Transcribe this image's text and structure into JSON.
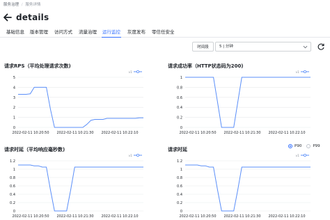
{
  "breadcrumb": {
    "root": "服务治理",
    "separator": "/",
    "current": "服务详情"
  },
  "page": {
    "title": "details"
  },
  "tabs": [
    "基础信息",
    "版本管理",
    "访问方式",
    "流量治理",
    "运行监控",
    "灰度发布",
    "零信任安全"
  ],
  "active_tab": "运行监控",
  "toolbar": {
    "time_label": "时间段",
    "time_value": "5 | 分钟"
  },
  "colors": {
    "accent": "#3370ff",
    "line": "#5b8ff9"
  },
  "charts": [
    {
      "title": "请求RPS（平均处理请求次数)",
      "legend": "v1"
    },
    {
      "title": "请求成功率（HTTP状态码为200)",
      "legend": "v1"
    },
    {
      "title": "请求时延（平均响应毫秒数)",
      "legend": "v1"
    },
    {
      "title": "请求时延",
      "legend": "v1"
    }
  ],
  "latency_percentiles": {
    "options": [
      "P90",
      "P99"
    ],
    "selected": "P90"
  },
  "chart_data": [
    {
      "type": "line",
      "title": "请求RPS（平均处理请求次数)",
      "ylim": [
        0,
        5
      ],
      "yticks": [
        "0",
        "1",
        "2",
        "3",
        "4",
        "5"
      ],
      "xticks": [
        "2022-02-11 10:20:50",
        "2022-02-11 10:21:30",
        "2022-02-11 10:22:10"
      ],
      "series": [
        {
          "name": "v1",
          "values": [
            3.3,
            3.3,
            3.3,
            3.35,
            4.0,
            4.0,
            4.0,
            4.0,
            1.8,
            0.0,
            0.0,
            0.0,
            0.0,
            0.0,
            0.0,
            0.0,
            0.0,
            0.3,
            0.7,
            0.8,
            0.8,
            0.8,
            0.9,
            0.9,
            0.9,
            0.9,
            0.9,
            0.9,
            0.9,
            0.9,
            0.95,
            0.95
          ]
        }
      ]
    },
    {
      "type": "line",
      "title": "请求成功率（HTTP状态码为200)",
      "ylim": [
        0,
        1
      ],
      "yticks": [
        "0",
        "0.2",
        "0.4",
        "0.6",
        "0.8",
        "1"
      ],
      "xticks": [
        "2022-02-11 10:20:50",
        "2022-02-11 10:21:30",
        "2022-02-11 10:22:10"
      ],
      "series": [
        {
          "name": "v1",
          "values": [
            1,
            1,
            1,
            1,
            1,
            1,
            1,
            1,
            0.5,
            0,
            0,
            0,
            0,
            0.5,
            1,
            1,
            1,
            1,
            1,
            1,
            1,
            1,
            1,
            1,
            1,
            1,
            1,
            1,
            1,
            1,
            1,
            1
          ]
        }
      ]
    },
    {
      "type": "line",
      "title": "请求时延（平均响应毫秒数)",
      "ylim": [
        0,
        1.2
      ],
      "yticks": [
        "0",
        "0.2",
        "0.4",
        "0.6",
        "0.8",
        "1",
        "1.2"
      ],
      "xticks": [
        "2022-02-11 10:20:50",
        "2022-02-11 10:21:30",
        "2022-02-11 10:22:10"
      ],
      "series": [
        {
          "name": "v1",
          "values": [
            1.1,
            1.1,
            1.1,
            1.1,
            1.08,
            1.08,
            1.05,
            1.05,
            0.5,
            0,
            0,
            0,
            0,
            0.5,
            1.05,
            1.05,
            1.05,
            1.05,
            1.05,
            1.05,
            1.05,
            1.05,
            1.05,
            1.05,
            1.05,
            1.05,
            1.05,
            1.05,
            1.05,
            1.05,
            1.05,
            1.05
          ]
        }
      ]
    },
    {
      "type": "line",
      "title": "请求时延",
      "ylim": [
        0,
        1.2
      ],
      "yticks": [
        "0",
        "0.2",
        "0.4",
        "0.6",
        "0.8",
        "1",
        "1.2"
      ],
      "xticks": [
        "2022-02-11 10:20:50",
        "2022-02-11 10:21:30",
        "2022-02-11 10:22:10"
      ],
      "series": [
        {
          "name": "v1",
          "values": [
            1.1,
            1.1,
            1.1,
            1.1,
            1.08,
            1.08,
            1.05,
            1.05,
            0.5,
            0,
            0,
            0,
            0,
            0.5,
            1.05,
            1.05,
            1.05,
            1.05,
            1.05,
            1.05,
            1.05,
            1.05,
            1.05,
            1.05,
            1.05,
            1.05,
            1.05,
            1.05,
            1.05,
            1.05,
            1.05,
            1.05
          ]
        }
      ]
    }
  ]
}
